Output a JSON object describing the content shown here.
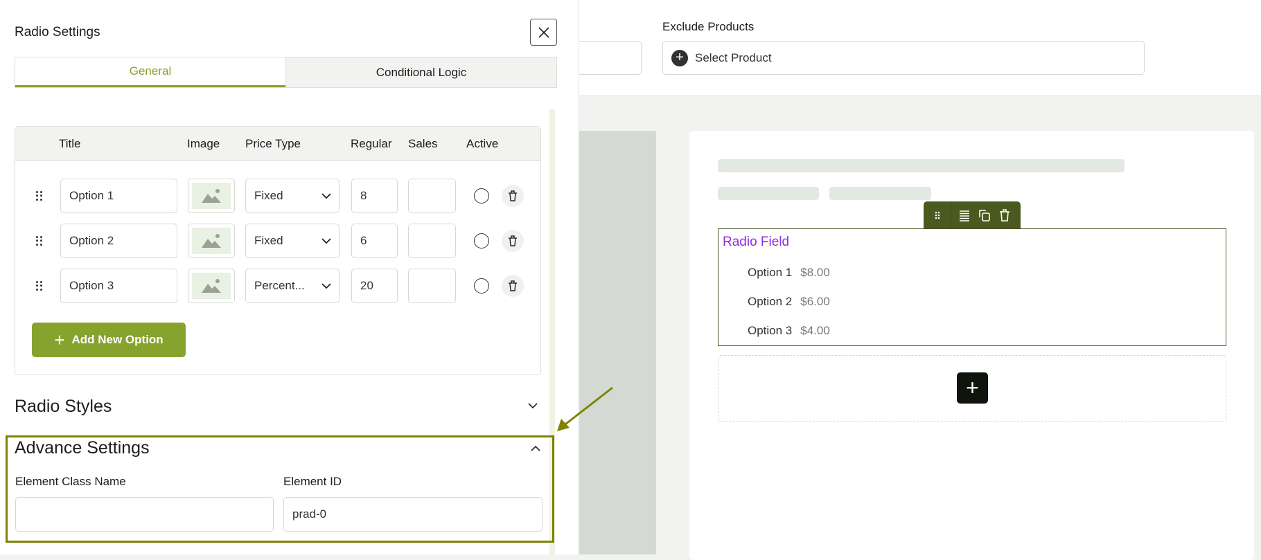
{
  "panel": {
    "title": "Radio Settings",
    "tabs": [
      {
        "label": "General",
        "active": true
      },
      {
        "label": "Conditional Logic",
        "active": false
      }
    ],
    "table_headers": [
      "Title",
      "Image",
      "Price Type",
      "Regular",
      "Sales",
      "Active"
    ],
    "rows": [
      {
        "title": "Option 1",
        "price_type": "Fixed",
        "regular": "8",
        "sales": ""
      },
      {
        "title": "Option 2",
        "price_type": "Fixed",
        "regular": "6",
        "sales": ""
      },
      {
        "title": "Option 3",
        "price_type": "Percent...",
        "regular": "20",
        "sales": ""
      }
    ],
    "add_option_label": "Add New Option",
    "radio_styles_label": "Radio Styles",
    "advance_settings_label": "Advance Settings",
    "class_name_label": "Element Class Name",
    "class_name_value": "",
    "element_id_label": "Element ID",
    "element_id_value": "prad-0"
  },
  "top": {
    "exclude_label": "Exclude Products",
    "select_product": "Select Product"
  },
  "preview": {
    "field_title": "Radio Field",
    "options": [
      {
        "label": "Option 1",
        "price": "$8.00"
      },
      {
        "label": "Option 2",
        "price": "$6.00"
      },
      {
        "label": "Option 3",
        "price": "$4.00"
      }
    ]
  },
  "colors": {
    "accent": "#86a32e",
    "highlight": "#7d8200",
    "toolbar": "#4a5a1e",
    "field_title": "#8e2de2"
  }
}
